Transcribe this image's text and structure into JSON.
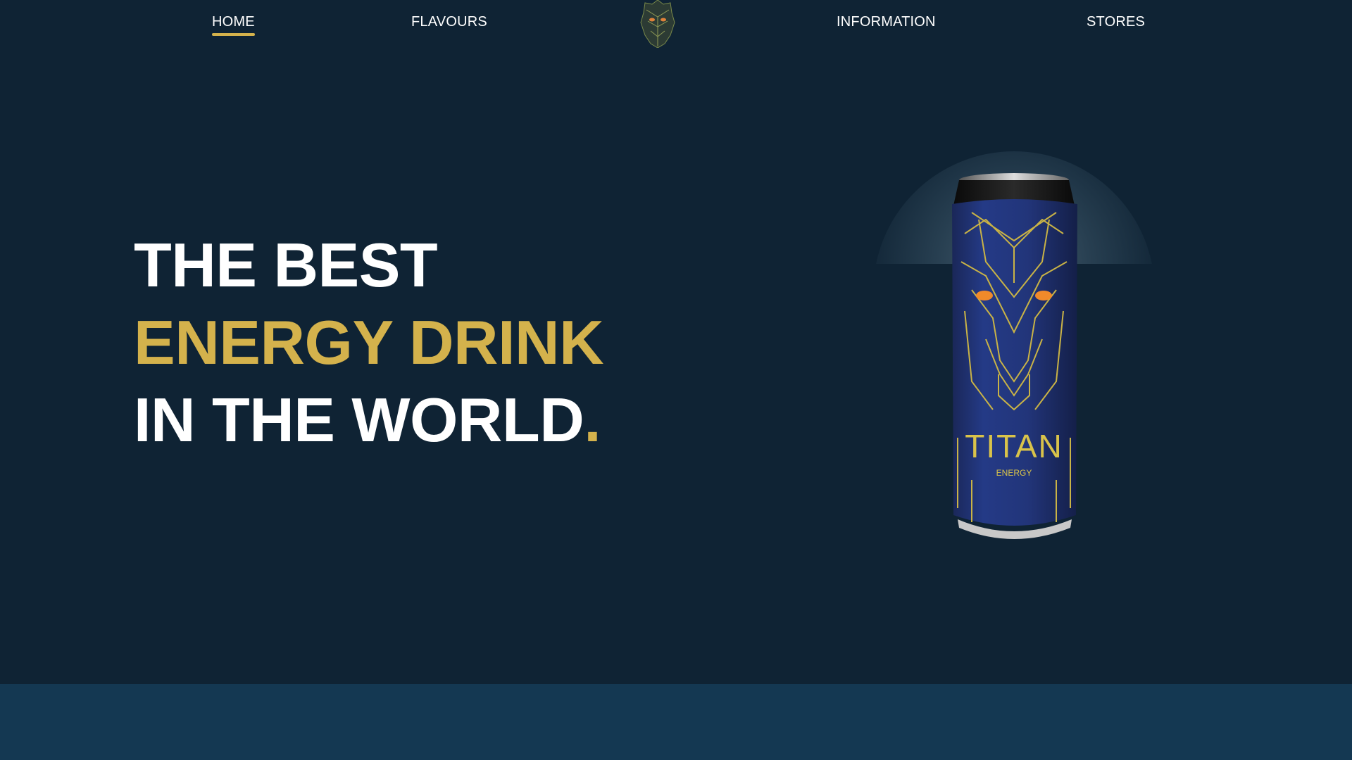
{
  "nav": {
    "home": "HOME",
    "flavours": "FLAVOURS",
    "information": "INFORMATION",
    "stores": "STORES",
    "logo_icon": "titan-mask-logo-icon"
  },
  "hero": {
    "line1": "THE BEST",
    "line2": "ENERGY DRINK",
    "line3": "IN THE WORLD",
    "period": "."
  },
  "product": {
    "brand": "TITAN",
    "subtitle": "ENERGY"
  },
  "colors": {
    "background": "#0f2334",
    "accent_gold": "#d4b24c",
    "can_blue": "#1e2f6a",
    "bottom_band": "#143852"
  }
}
